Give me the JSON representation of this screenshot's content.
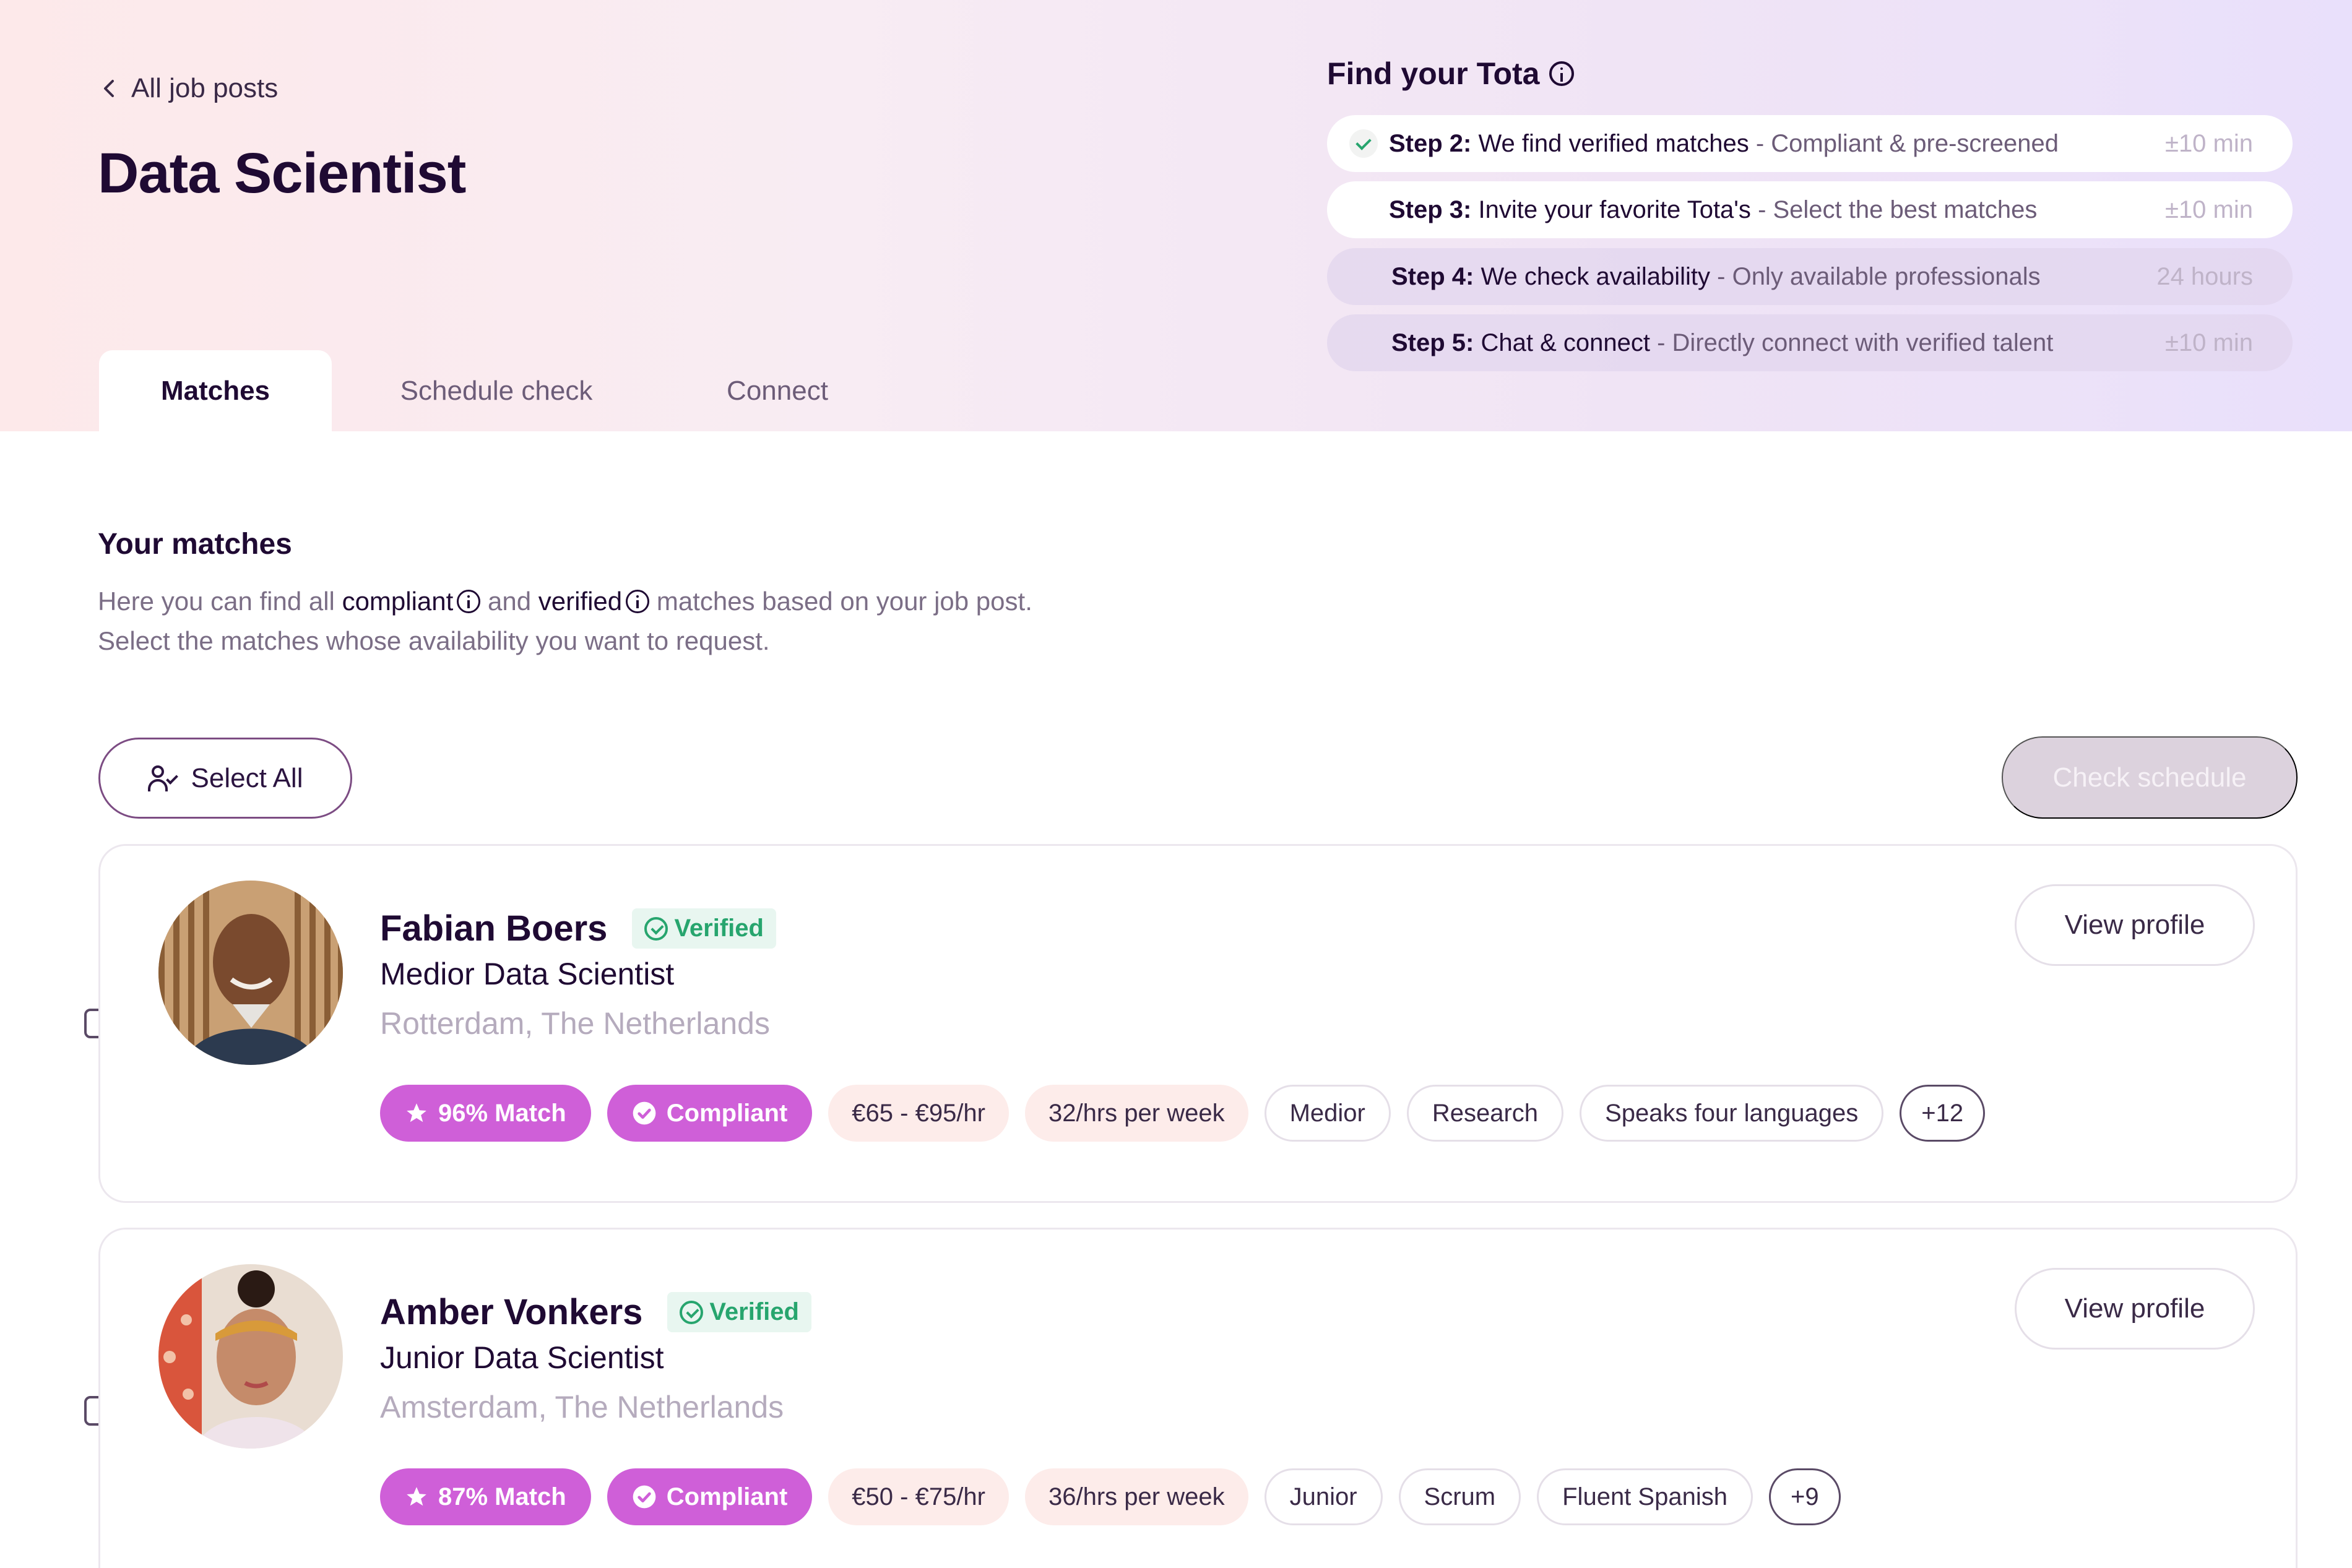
{
  "nav": {
    "back_label": "All job posts"
  },
  "page": {
    "title": "Data Scientist"
  },
  "tabs": [
    {
      "label": "Matches",
      "active": true
    },
    {
      "label": "Schedule check",
      "active": false
    },
    {
      "label": "Connect",
      "active": false
    }
  ],
  "steps_panel": {
    "title": "Find your Tota",
    "steps": [
      {
        "label": "Step 2:",
        "title": "We find verified matches",
        "desc": "- Compliant & pre-screened",
        "time": "±10 min",
        "state": "done"
      },
      {
        "label": "Step 3:",
        "title": "Invite your favorite Tota's",
        "desc": "- Select the best matches",
        "time": "±10 min",
        "state": "current"
      },
      {
        "label": "Step 4:",
        "title": "We check availability",
        "desc": "- Only available professionals",
        "time": "24 hours",
        "state": "pending"
      },
      {
        "label": "Step 5:",
        "title": "Chat & connect",
        "desc": "- Directly connect with verified talent",
        "time": "±10 min",
        "state": "pending"
      }
    ]
  },
  "matches_section": {
    "title": "Your matches",
    "desc_prefix": "Here you can find all",
    "compliant_word": "compliant",
    "and_word": "and",
    "verified_word": "verified",
    "desc_suffix": "matches based on your job post.",
    "desc_line2": "Select the matches whose availability you want to request."
  },
  "actions": {
    "select_all_label": "Select All",
    "check_schedule_label": "Check schedule"
  },
  "candidates": [
    {
      "name": "Fabian Boers",
      "verified_label": "Verified",
      "role": "Medior Data Scientist",
      "location": "Rotterdam, The Netherlands",
      "view_profile_label": "View profile",
      "match_label": "96% Match",
      "compliant_label": "Compliant",
      "rate": "€65 - €95/hr",
      "hours": "32/hrs per week",
      "skills": [
        "Medior",
        "Research",
        "Speaks four languages"
      ],
      "more": "+12",
      "selected": false
    },
    {
      "name": "Amber Vonkers",
      "verified_label": "Verified",
      "role": "Junior Data Scientist",
      "location": "Amsterdam, The Netherlands",
      "view_profile_label": "View profile",
      "match_label": "87% Match",
      "compliant_label": "Compliant",
      "rate": "€50 - €75/hr",
      "hours": "36/hrs per week",
      "skills": [
        "Junior",
        "Scrum",
        "Fluent Spanish"
      ],
      "more": "+9",
      "selected": false
    }
  ],
  "colors": {
    "brand_purple": "#cf5fd8",
    "verified_green": "#27a56e",
    "heading": "#1f0a33",
    "disabled_button": "#dcd2dd"
  }
}
